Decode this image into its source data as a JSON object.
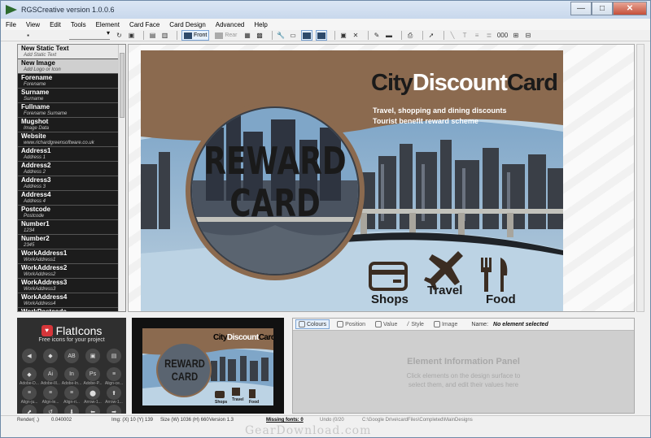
{
  "window": {
    "title": "RGSCreative version 1.0.0.6",
    "minimize_glyph": "—",
    "maximize_glyph": "□",
    "close_glyph": "✕"
  },
  "menu": [
    "File",
    "View",
    "Edit",
    "Tools",
    "Element",
    "Card Face",
    "Card Design",
    "Advanced",
    "Help"
  ],
  "toolbar": {
    "front_label": "Front",
    "rear_label": "Rear",
    "zoom_label": "000"
  },
  "fields": [
    {
      "name": "New Static Text",
      "sub": "Add Static Text",
      "style": "light"
    },
    {
      "name": "New Image",
      "sub": "Add Logo or Icon",
      "style": "light2"
    },
    {
      "name": "Forename",
      "sub": "Forename",
      "style": "dark"
    },
    {
      "name": "Surname",
      "sub": "Surname",
      "style": "dark"
    },
    {
      "name": "Fullname",
      "sub": "Forename Surname",
      "style": "dark"
    },
    {
      "name": "Mugshot",
      "sub": "Image Data",
      "style": "dark"
    },
    {
      "name": "Website",
      "sub": "www.richardgreensoftware.co.uk",
      "style": "dark"
    },
    {
      "name": "Address1",
      "sub": "Address 1",
      "style": "dark"
    },
    {
      "name": "Address2",
      "sub": "Address 2",
      "style": "dark"
    },
    {
      "name": "Address3",
      "sub": "Address 3",
      "style": "dark"
    },
    {
      "name": "Address4",
      "sub": "Address 4",
      "style": "dark"
    },
    {
      "name": "Postcode",
      "sub": "Postcode",
      "style": "dark"
    },
    {
      "name": "Number1",
      "sub": "1234",
      "style": "dark"
    },
    {
      "name": "Number2",
      "sub": "2345",
      "style": "dark"
    },
    {
      "name": "WorkAddress1",
      "sub": "WorkAddress1",
      "style": "dark"
    },
    {
      "name": "WorkAddress2",
      "sub": "WorkAddress2",
      "style": "dark"
    },
    {
      "name": "WorkAddress3",
      "sub": "WorkAddress3",
      "style": "dark"
    },
    {
      "name": "WorkAddress4",
      "sub": "WorkAddress4",
      "style": "dark"
    },
    {
      "name": "WorkPostcode",
      "sub": "",
      "style": "dark"
    }
  ],
  "card": {
    "brand_city": "City",
    "brand_discount": "Discount",
    "brand_card": "Card",
    "tagline1": "Travel, shopping and dining discounts",
    "tagline2": "Tourist benefit reward scheme",
    "reward1": "REWARD",
    "reward2": "CARD",
    "icon_shops": "Shops",
    "icon_travel": "Travel",
    "icon_food": "Food",
    "colors": {
      "brown": "#8b6a4f",
      "sky": "#bcd3e4",
      "dark": "#1a1a1a"
    }
  },
  "flaticons": {
    "brand": "FlatIcons",
    "tagline": "Free icons for your project",
    "icons": [
      {
        "label": "",
        "glyph": "◀"
      },
      {
        "label": "",
        "glyph": "◆"
      },
      {
        "label": "",
        "glyph": "AB"
      },
      {
        "label": "",
        "glyph": "▣"
      },
      {
        "label": "",
        "glyph": "▤"
      },
      {
        "label": "Adobe-D...",
        "glyph": "◆"
      },
      {
        "label": "Adobe-Ill...",
        "glyph": "Ai"
      },
      {
        "label": "Adobe-In...",
        "glyph": "In"
      },
      {
        "label": "Adobe-P...",
        "glyph": "Ps"
      },
      {
        "label": "Align-ce...",
        "glyph": "≡"
      },
      {
        "label": "Align-ju...",
        "glyph": "≡"
      },
      {
        "label": "Align-le...",
        "glyph": "≡"
      },
      {
        "label": "Align-ri...",
        "glyph": "≡"
      },
      {
        "label": "Arrow-1...",
        "glyph": "⬤"
      },
      {
        "label": "Arrow-1...",
        "glyph": "⬆"
      },
      {
        "label": "Align-...",
        "glyph": "⬈"
      },
      {
        "label": "Align-...",
        "glyph": "↺"
      },
      {
        "label": "Align-...",
        "glyph": "⬇"
      },
      {
        "label": "Align-...",
        "glyph": "⬅"
      },
      {
        "label": "Align-...",
        "glyph": "➡"
      },
      {
        "label": "",
        "glyph": "✕"
      },
      {
        "label": "",
        "glyph": "⬇"
      },
      {
        "label": "",
        "glyph": "⬤"
      },
      {
        "label": "",
        "glyph": "▼"
      },
      {
        "label": "",
        "glyph": "➘"
      }
    ]
  },
  "panel": {
    "tabs": [
      "Colours",
      "Position",
      "Value",
      "Style",
      "Image"
    ],
    "name_label": "Name:",
    "name_value": "No element selected",
    "title": "Element Information Panel",
    "desc1": "Click elements on the design surface to",
    "desc2": "select them, and edit their values here"
  },
  "status": {
    "render": "Render( ,)",
    "time": "0.040002",
    "img": "Img: (X) 10 (Y) 139",
    "size": "Size (W) 1036 (H) 660",
    "version": "Version 1.3",
    "missing": "Missing fonts: 0",
    "undo": "Undo (0/20",
    "path": "C:\\Google Drive\\cardFiles\\Completed\\MainDesigns"
  },
  "watermark": "GearDownload.com"
}
